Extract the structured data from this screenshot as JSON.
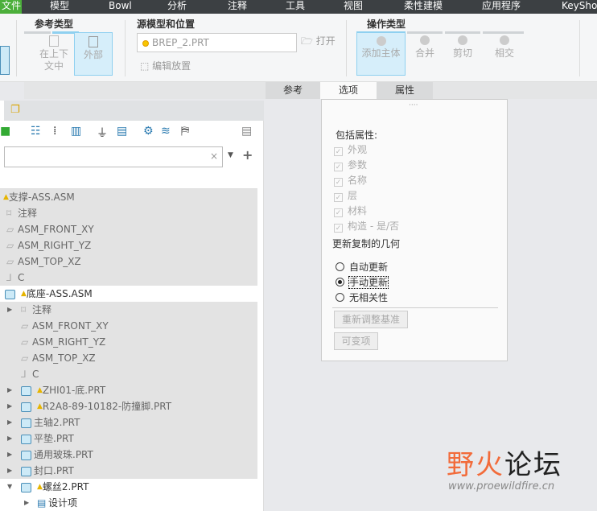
{
  "menubar": {
    "items": [
      "文件",
      "模型",
      "Bowl",
      "分析",
      "注释",
      "工具",
      "视图",
      "柔性建模",
      "应用程序",
      "KeySho"
    ]
  },
  "ribbon": {
    "ref_type": {
      "title": "参考类型",
      "buttons": [
        "在上下文中",
        "外部"
      ],
      "selected": "外部"
    },
    "source": {
      "title": "源模型和位置",
      "model": "BREP_2.PRT",
      "open": "打开",
      "edit_placement": "编辑放置"
    },
    "operation": {
      "title": "操作类型",
      "buttons": [
        "添加主体",
        "合并",
        "剪切",
        "相交"
      ],
      "selected": "添加主体"
    }
  },
  "tabs": [
    "参考",
    "选项",
    "属性"
  ],
  "active_tab": "选项",
  "tree": {
    "search_value": "",
    "rows": [
      {
        "label": "支撑-ASS.ASM",
        "warn": true
      },
      {
        "label": "注释"
      },
      {
        "label": "ASM_FRONT_XY"
      },
      {
        "label": "ASM_RIGHT_YZ"
      },
      {
        "label": "ASM_TOP_XZ"
      },
      {
        "label": "C"
      },
      {
        "label": "底座-ASS.ASM",
        "warn": true
      },
      {
        "label": "注释"
      },
      {
        "label": "ASM_FRONT_XY"
      },
      {
        "label": "ASM_RIGHT_YZ"
      },
      {
        "label": "ASM_TOP_XZ"
      },
      {
        "label": "C"
      },
      {
        "label": "ZHI01-底.PRT",
        "warn": true
      },
      {
        "label": "R2A8-89-10182-防撞脚.PRT",
        "warn": true
      },
      {
        "label": "主轴2.PRT"
      },
      {
        "label": "平垫.PRT"
      },
      {
        "label": "通用玻珠.PRT"
      },
      {
        "label": "封口.PRT"
      },
      {
        "label": "螺丝2.PRT",
        "warn": true
      },
      {
        "label": "设计项"
      }
    ]
  },
  "options": {
    "include_label": "包括属性:",
    "checkboxes": [
      {
        "label": "外观",
        "checked": true
      },
      {
        "label": "参数",
        "checked": true
      },
      {
        "label": "名称",
        "checked": true
      },
      {
        "label": "层",
        "checked": true
      },
      {
        "label": "材料",
        "checked": true
      },
      {
        "label": "构造 - 是/否",
        "checked": true
      }
    ],
    "update_label": "更新复制的几何",
    "radios": [
      "自动更新",
      "手动更新",
      "无相关性"
    ],
    "selected_radio": "手动更新",
    "buttons": [
      "重新调整基准",
      "可变项"
    ]
  },
  "watermark": {
    "title": "野火论坛",
    "url": "www.proewildfire.cn"
  }
}
